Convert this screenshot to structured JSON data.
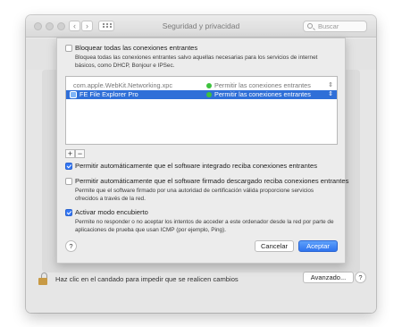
{
  "window": {
    "title": "Seguridad y privacidad",
    "search_placeholder": "Buscar",
    "icons": {
      "back": "chevron-left-icon",
      "forward": "chevron-right-icon",
      "grid": "grid-icon",
      "search": "search-icon",
      "lock": "lock-open-icon"
    }
  },
  "sheet": {
    "block_all": {
      "label": "Bloquear todas las conexiones entrantes",
      "description": "Bloquea todas las conexiones entrantes salvo aquellas necesarias para los servicios de internet básicos, como DHCP, Bonjour e IPSec.",
      "checked": false
    },
    "apps": [
      {
        "name": "com.apple.WebKit.Networking.xpc",
        "permission": "Permitir las conexiones entrantes",
        "selected": false
      },
      {
        "name": "FE File Explorer Pro",
        "permission": "Permitir las conexiones entrantes",
        "selected": true
      }
    ],
    "add_label": "+",
    "remove_label": "−",
    "builtin_software": {
      "label": "Permitir automáticamente que el software integrado reciba conexiones entrantes",
      "checked": true
    },
    "signed_software": {
      "label": "Permitir automáticamente que el software firmado descargado reciba conexiones entrantes",
      "description": "Permite que el software firmado por una autoridad de certificación válida proporcione servicios ofrecidos a través de la red.",
      "checked": false
    },
    "stealth_mode": {
      "label": "Activar modo encubierto",
      "description": "Permite no responder o no aceptar los intentos de acceder a este ordenador desde la red por parte de aplicaciones de prueba que usan ICMP (por ejemplo, Ping).",
      "checked": true
    },
    "help_label": "?",
    "cancel_label": "Cancelar",
    "accept_label": "Aceptar"
  },
  "footer": {
    "lock_text": "Haz clic en el candado para impedir que se realicen cambios",
    "advanced_label": "Avanzado...",
    "help_label": "?"
  },
  "colors": {
    "accent": "#2f74ee",
    "selection": "#2f6fd8",
    "status_green": "#3dc23d"
  }
}
